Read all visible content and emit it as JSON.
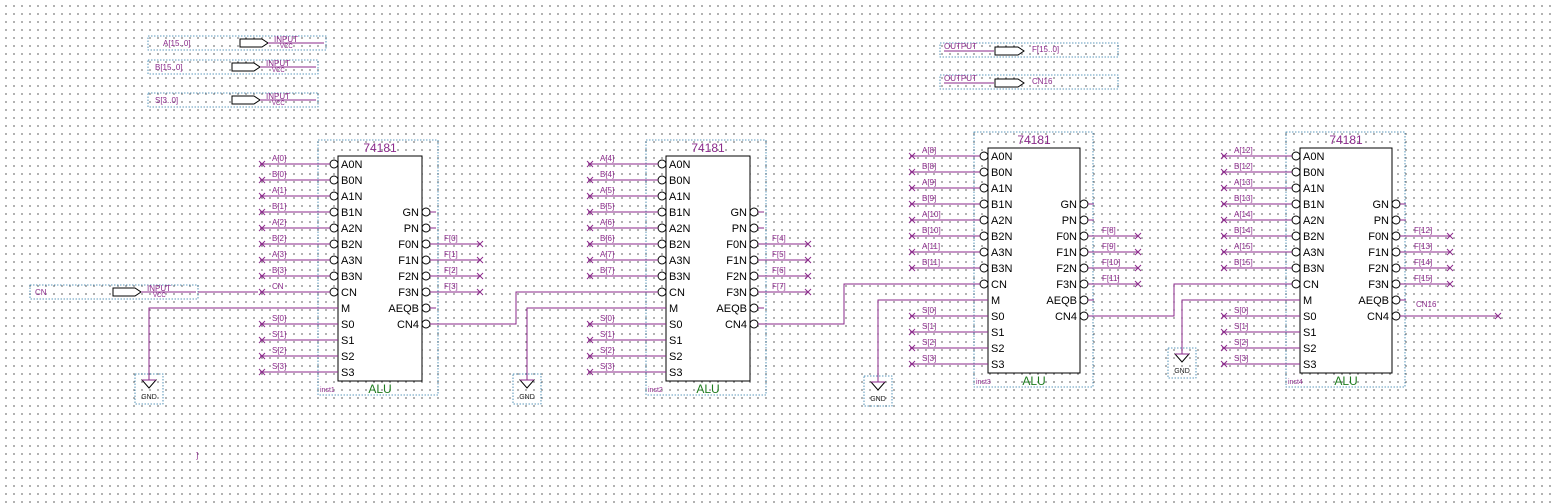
{
  "inputs": [
    {
      "name": "A[15..0]",
      "tag": "INPUT",
      "sub": "VCC"
    },
    {
      "name": "B[15..0]",
      "tag": "INPUT",
      "sub": "VCC"
    },
    {
      "name": "S[3..0]",
      "tag": "INPUT",
      "sub": "VCC"
    },
    {
      "name": "CN",
      "tag": "INPUT",
      "sub": "VCC"
    }
  ],
  "outputs": [
    {
      "name": "F[15..0]",
      "tag": "OUTPUT"
    },
    {
      "name": "CN16",
      "tag": "OUTPUT"
    }
  ],
  "chip": {
    "title": "74181",
    "type": "ALU",
    "left_pins": [
      "A0N",
      "B0N",
      "A1N",
      "B1N",
      "A2N",
      "B2N",
      "A3N",
      "B3N",
      "CN",
      "M",
      "S0",
      "S1",
      "S2",
      "S3"
    ],
    "right_pins": [
      "GN",
      "PN",
      "F0N",
      "F1N",
      "F2N",
      "F3N",
      "AEQB",
      "CN4"
    ]
  },
  "gnd_label": "GND",
  "instances": [
    {
      "inst": "inst1",
      "left": [
        "A[0]",
        "B[0]",
        "A[1]",
        "B[1]",
        "A[2]",
        "B[2]",
        "A[3]",
        "B[3]",
        "CN",
        "",
        "S[0]",
        "S[1]",
        "S[2]",
        "S[3]"
      ],
      "right": [
        "",
        "",
        "F[0]",
        "F[1]",
        "F[2]",
        "F[3]",
        "",
        ""
      ]
    },
    {
      "inst": "inst2",
      "left": [
        "A[4]",
        "B[4]",
        "A[5]",
        "B[5]",
        "A[6]",
        "B[6]",
        "A[7]",
        "B[7]",
        "",
        "",
        "S[0]",
        "S[1]",
        "S[2]",
        "S[3]"
      ],
      "right": [
        "",
        "",
        "F[4]",
        "F[5]",
        "F[6]",
        "F[7]",
        "",
        ""
      ]
    },
    {
      "inst": "inst3",
      "left": [
        "A[8]",
        "B[8]",
        "A[9]",
        "B[9]",
        "A[10]",
        "B[10]",
        "A[11]",
        "B[11]",
        "",
        "",
        "S[0]",
        "S[1]",
        "S[2]",
        "S[3]"
      ],
      "right": [
        "",
        "",
        "F[8]",
        "F[9]",
        "F[10]",
        "F[11]",
        "",
        ""
      ]
    },
    {
      "inst": "inst4",
      "left": [
        "A[12]",
        "B[12]",
        "A[13]",
        "B[13]",
        "A[14]",
        "B[14]",
        "A[15]",
        "B[15]",
        "",
        "",
        "S[0]",
        "S[1]",
        "S[2]",
        "S[3]"
      ],
      "right": [
        "",
        "",
        "F[12]",
        "F[13]",
        "F[14]",
        "F[15]",
        "",
        "CN16"
      ]
    }
  ],
  "misc_text": "]"
}
